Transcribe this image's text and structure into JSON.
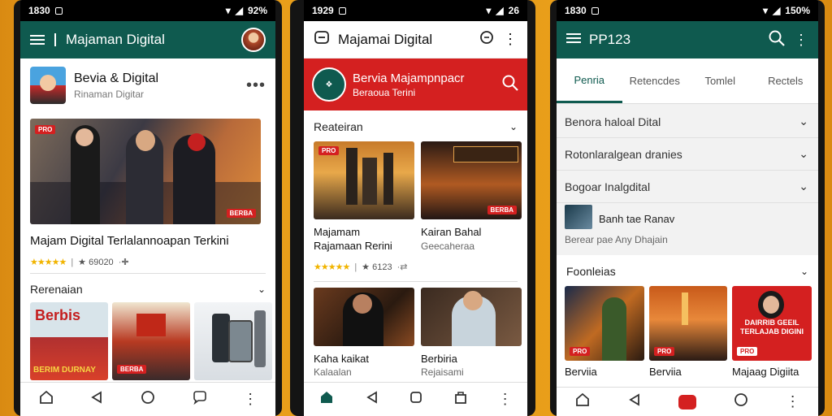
{
  "phone1": {
    "status_time": "1830",
    "status_battery": "92%",
    "app_title": "Majaman Digital",
    "channel_name": "Bevia & Digital",
    "channel_sub": "Rinaman Digitar",
    "hero_tag": "PRO",
    "hero_tag2": "BERBA",
    "headline": "Majam Digital Terlalannoapan Terkini",
    "rating_text": "★ 69020",
    "section_title": "Rerenaian",
    "thumb1_text": "Berbis",
    "thumb1_sub": "BERIM DURNAY",
    "thumb2_tag": "BERBA",
    "colors": {
      "appbar": "#0f5a4f",
      "accent": "#d42020"
    }
  },
  "phone2": {
    "status_time": "1929",
    "status_battery": "26",
    "app_title": "Majamai Digital",
    "banner_title": "Bervia Majampnpacr",
    "banner_sub": "Beraoua Terini",
    "section_title": "Reateiran",
    "card1_tag": "PRO",
    "card1_title": "Majamam",
    "card1_sub": "Rajamaan Rerini",
    "card2_tag": "BERBA",
    "card2_title": "Kairan Bahal",
    "card2_sub": "Geecaheraa",
    "rating_text": "★ 6123",
    "card3_title": "Kaha kaikat",
    "card3_sub": "Kalaalan",
    "card4_title": "Berbiria",
    "card4_sub": "Rejaisami",
    "colors": {
      "banner": "#d42020",
      "nav_active": "#0f5a4f"
    }
  },
  "phone3": {
    "status_time": "1830",
    "status_battery": "150%",
    "app_title": "PP123",
    "tabs": [
      "Penria",
      "Retencdes",
      "Tomlel",
      "Rectels"
    ],
    "rows": [
      "Benora haloal Dital",
      "Rotonlaralgean dranies",
      "Bogoar Inalgdital"
    ],
    "news_title": "Banh tae Ranav",
    "news_sub": "Berear pae Any Dhajain",
    "section_title": "Foonleias",
    "cards": [
      {
        "tag": "PRO",
        "title": "Berviia"
      },
      {
        "tag": "PRO",
        "title": "Berviia"
      },
      {
        "tag": "PRO",
        "title": "Majaag Digiita",
        "overlay": "DAIRRIB GEEIL TERLAJAB DIGINI"
      }
    ],
    "colors": {
      "appbar": "#0f5a4f",
      "tab_indicator": "#0f5a4f",
      "accent": "#d42020"
    }
  }
}
